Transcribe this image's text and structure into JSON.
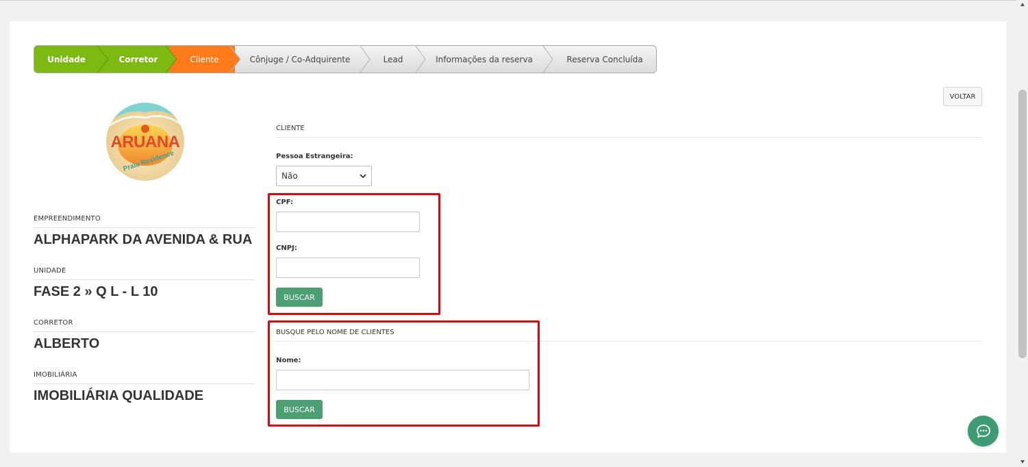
{
  "stepper": {
    "steps": [
      {
        "label": "Unidade",
        "state": "done"
      },
      {
        "label": "Corretor",
        "state": "done"
      },
      {
        "label": "Cliente",
        "state": "active"
      },
      {
        "label": "Cônjuge / Co-Adquirente",
        "state": "pending"
      },
      {
        "label": "Lead",
        "state": "pending"
      },
      {
        "label": "Informações da reserva",
        "state": "pending"
      },
      {
        "label": "Reserva Concluída",
        "state": "pending"
      }
    ]
  },
  "logo": {
    "title": "ARUANA",
    "subtitle": "Praia Residence"
  },
  "sidebar": {
    "empreendimento_label": "EMPREENDIMENTO",
    "empreendimento_value": "ALPHAPARK DA AVENIDA & RUA",
    "unidade_label": "UNIDADE",
    "unidade_value": "FASE 2 » Q L - L 10",
    "corretor_label": "CORRETOR",
    "corretor_value": "ALBERTO",
    "imobiliaria_label": "IMOBILIÁRIA",
    "imobiliaria_value": "IMOBILIÁRIA QUALIDADE"
  },
  "header": {
    "voltar_label": "VOLTAR"
  },
  "cliente_form": {
    "section_title": "CLIENTE",
    "estrangeira_label": "Pessoa Estrangeira:",
    "estrangeira_value": "Não",
    "cpf_label": "CPF:",
    "cpf_value": "",
    "cnpj_label": "CNPJ:",
    "cnpj_value": "",
    "buscar_label": "BUSCAR"
  },
  "nome_search": {
    "section_title": "BUSQUE PELO NOME DE CLIENTES",
    "nome_label": "Nome:",
    "nome_value": "",
    "buscar_label": "BUSCAR"
  },
  "colors": {
    "step_done": "#7cba12",
    "step_active": "#ff7a1a",
    "buscar_button": "#4c9e73",
    "highlight_box": "#e8000b",
    "chat_button": "#3f9b73"
  },
  "icons": {
    "chat": "chat-bubble-icon",
    "select_arrow": "chevron-down-icon"
  }
}
